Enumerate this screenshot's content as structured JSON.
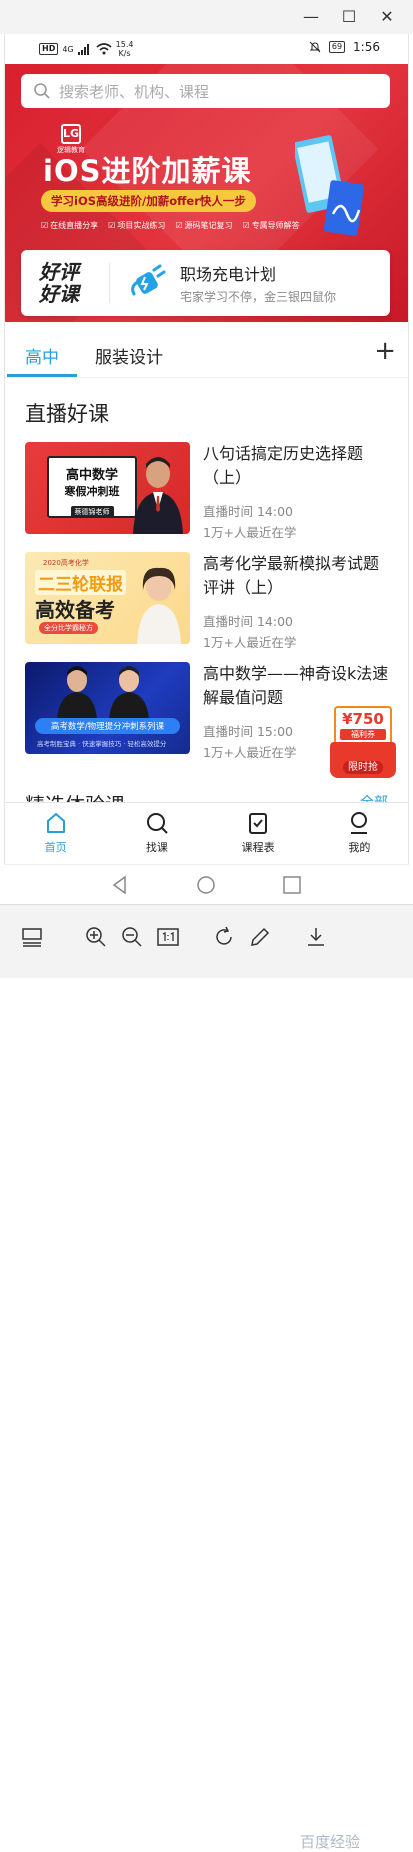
{
  "status_bar": {
    "network": "HD",
    "signal": "4G",
    "speed_value": "15.4",
    "speed_unit": "K/s",
    "battery": "69",
    "time": "1:56"
  },
  "search": {
    "placeholder": "搜索老师、机构、课程"
  },
  "banner": {
    "logo_mark": "LG",
    "logo_text": "逻辑教育",
    "title": "iOS进阶加薪课",
    "subtitle": "学习iOS高级进阶/加薪offer快人一步",
    "tags": [
      "在线直播分享",
      "项目实战练习",
      "源码笔记复习",
      "专属导师解答"
    ],
    "dot_count": 9,
    "active_dot": 3
  },
  "promo": {
    "logo_line1": "好评",
    "logo_line2": "好课",
    "title": "职场充电计划",
    "subtitle": "宅家学习不停，金三银四鼠你"
  },
  "tabs": {
    "items": [
      "高中",
      "服装设计"
    ],
    "active": 0,
    "add_label": "+"
  },
  "live_section": {
    "title": "直播好课"
  },
  "courses": [
    {
      "title": "八句话搞定历史选择题（上）",
      "time": "直播时间 14:00",
      "views": "1万+人最近在学",
      "thumb_line1": "高中数学",
      "thumb_line2": "寒假冲刺班",
      "thumb_badge": "蔡德锦老师"
    },
    {
      "title": "高考化学最新模拟考试题评讲（上）",
      "time": "直播时间 14:00",
      "views": "1万+人最近在学",
      "thumb_line1": "2020高考化学",
      "thumb_line2": "二三轮联报",
      "thumb_line3": "高效备考",
      "thumb_badge": "全分比学霸秘方"
    },
    {
      "title": "高中数学——神奇设k法速解最值问题",
      "time": "直播时间 15:00",
      "views": "1万+人最近在学",
      "thumb_line1": "高考数学/物理提分冲刺系列课",
      "thumb_line2": "高考制胜宝典 · 快速掌握技巧 · 轻松高效提分"
    }
  ],
  "coupon": {
    "value": "¥750",
    "label": "福利券",
    "action": "限时抢"
  },
  "next_section": {
    "title": "精选体验课",
    "more": "全部"
  },
  "bottom_nav": [
    {
      "label": "首页",
      "icon": "home-icon"
    },
    {
      "label": "找课",
      "icon": "search-icon"
    },
    {
      "label": "课程表",
      "icon": "schedule-icon"
    },
    {
      "label": "我的",
      "icon": "profile-icon"
    }
  ],
  "watermark": "百度经验",
  "colors": {
    "accent": "#2a9fd6",
    "banner_red": "#d8202f",
    "coupon_red": "#e8392b"
  }
}
